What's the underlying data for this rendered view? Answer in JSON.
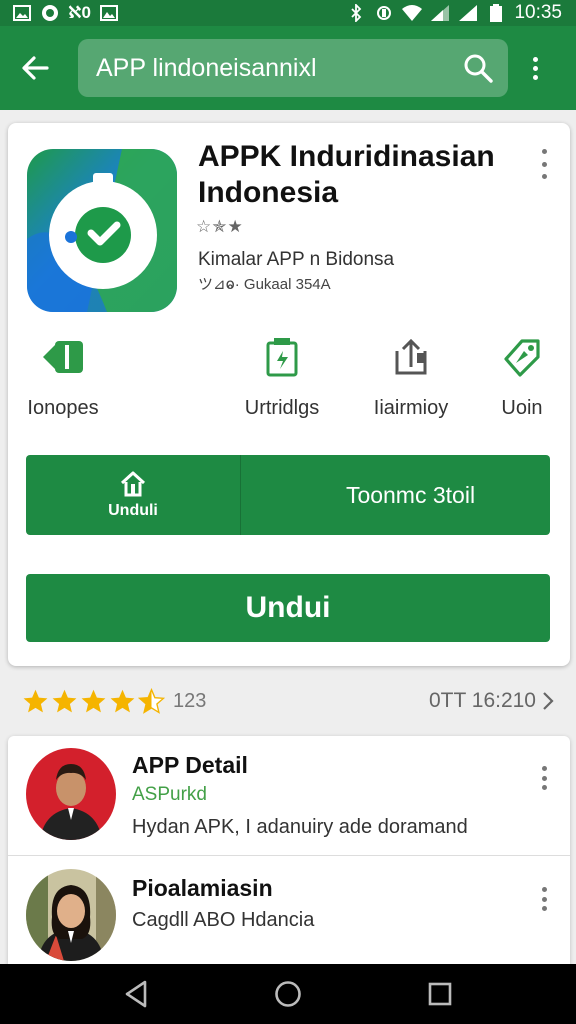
{
  "status_bar": {
    "left_icons": [
      "image-icon",
      "browser-icon",
      "notification-icon",
      "gallery-icon"
    ],
    "notif_text": "ℵ0",
    "time": "10:35",
    "right_icons": [
      "bluetooth-icon",
      "sync-icon",
      "wifi-icon",
      "signal-icon",
      "signal-icon",
      "battery-icon"
    ]
  },
  "app_bar": {
    "search_query": "APP lindoneisannixl",
    "back_icon": "arrow-left-icon",
    "search_icon": "search-icon"
  },
  "app": {
    "title": "APPK Induridinasian Indonesia",
    "mini_rating": "☆✯★",
    "developer": "Kimalar APP n Bidonsa",
    "size_info": "ツ⊿ⱺ· Gukaal 354A",
    "colors": {
      "brand_green": "#1e8a43",
      "icon_blue": "#1a73d9",
      "icon_green": "#2faa49"
    }
  },
  "actions": [
    {
      "label": "Ionopes",
      "icon": "share-icon"
    },
    {
      "label": "Urtridlgs",
      "icon": "document-icon"
    },
    {
      "label": "Iiairmioy",
      "icon": "upload-icon"
    },
    {
      "label": "Uoin",
      "icon": "tag-icon"
    }
  ],
  "split_button": {
    "left_label": "Unduli",
    "right_label": "Toonmc 3toil"
  },
  "install_button": {
    "label": "Undui"
  },
  "rating": {
    "stars": 4.5,
    "count": "123",
    "date": "0TT 16:210"
  },
  "list": [
    {
      "title": "APP Detail",
      "subtitle": "ASPurkd",
      "description": "Hydan APK, I adanuiry ade doramand",
      "avatar": "avatar-woman-red"
    },
    {
      "title": "Pioalamiasin",
      "subtitle": "",
      "description": "Cagdll ABO Hdancia",
      "avatar": "avatar-woman-office"
    }
  ],
  "nav": {
    "back": "nav-back-icon",
    "home": "nav-home-icon",
    "recents": "nav-recents-icon"
  }
}
